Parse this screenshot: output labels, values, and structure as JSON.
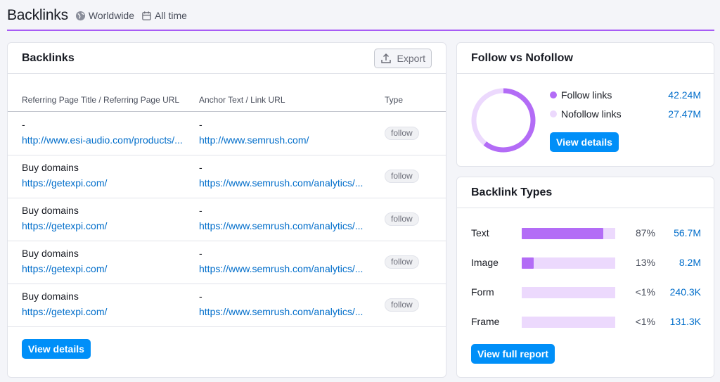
{
  "header": {
    "title": "Backlinks",
    "region": "Worldwide",
    "period": "All time",
    "accent": "#a75cf5"
  },
  "backlinks_card": {
    "title": "Backlinks",
    "export_label": "Export",
    "columns": [
      "Referring Page Title / Referring Page URL",
      "Anchor Text / Link URL",
      "Type"
    ],
    "rows": [
      {
        "title": "-",
        "url": "http://www.esi-audio.com/products/...",
        "anchor": "-",
        "link": "http://www.semrush.com/",
        "type": "follow"
      },
      {
        "title": "Buy domains",
        "url": "https://getexpi.com/",
        "anchor": "-",
        "link": "https://www.semrush.com/analytics/...",
        "type": "follow"
      },
      {
        "title": "Buy domains",
        "url": "https://getexpi.com/",
        "anchor": "-",
        "link": "https://www.semrush.com/analytics/...",
        "type": "follow"
      },
      {
        "title": "Buy domains",
        "url": "https://getexpi.com/",
        "anchor": "-",
        "link": "https://www.semrush.com/analytics/...",
        "type": "follow"
      },
      {
        "title": "Buy domains",
        "url": "https://getexpi.com/",
        "anchor": "-",
        "link": "https://www.semrush.com/analytics/...",
        "type": "follow"
      }
    ],
    "view_details_label": "View details"
  },
  "follow_card": {
    "title": "Follow vs Nofollow",
    "items": [
      {
        "label": "Follow links",
        "value": "42.24M",
        "color": "#b36cf6",
        "share": 0.606
      },
      {
        "label": "Nofollow links",
        "value": "27.47M",
        "color": "#ecd9fd",
        "share": 0.394
      }
    ],
    "view_details_label": "View details"
  },
  "types_card": {
    "title": "Backlink Types",
    "items": [
      {
        "label": "Text",
        "pct": "87%",
        "value": "56.7M",
        "share": 0.87
      },
      {
        "label": "Image",
        "pct": "13%",
        "value": "8.2M",
        "share": 0.13
      },
      {
        "label": "Form",
        "pct": "<1%",
        "value": "240.3K",
        "share": 0.0
      },
      {
        "label": "Frame",
        "pct": "<1%",
        "value": "131.3K",
        "share": 0.0
      }
    ],
    "view_full_label": "View full report"
  }
}
